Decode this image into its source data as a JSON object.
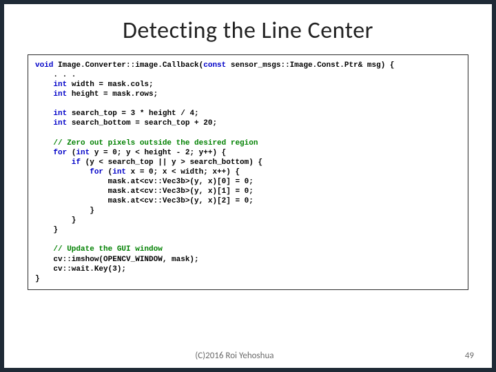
{
  "title": "Detecting the Line Center",
  "footer": {
    "copyright": "(C)2016 Roi Yehoshua",
    "page": "49"
  },
  "code": {
    "l1a": "void",
    "l1b": " Image.Converter::image.Callback(",
    "l1c": "const",
    "l1d": " sensor_msgs::Image.Const.Ptr& msg) {",
    "l2": "    . . .",
    "l3a": "    int",
    "l3b": " width = mask.cols;",
    "l4a": "    int",
    "l4b": " height = mask.rows;",
    "blank1": " ",
    "l5a": "    int",
    "l5b": " search_top = 3 * height / 4;",
    "l6a": "    int",
    "l6b": " search_bottom = search_top + 20;",
    "blank2": " ",
    "c1": "    // Zero out pixels outside the desired region",
    "l7a": "    for",
    "l7b": " (",
    "l7c": "int",
    "l7d": " y = 0; y < height - 2; y++) {",
    "l8a": "        if",
    "l8b": " (y < search_top || y > search_bottom) {",
    "l9a": "            for",
    "l9b": " (",
    "l9c": "int",
    "l9d": " x = 0; x < width; x++) {",
    "l10": "                mask.at<cv::Vec3b>(y, x)[0] = 0;",
    "l11": "                mask.at<cv::Vec3b>(y, x)[1] = 0;",
    "l12": "                mask.at<cv::Vec3b>(y, x)[2] = 0;",
    "l13": "            }",
    "l14": "        }",
    "l15": "    }",
    "blank3": " ",
    "c2": "    // Update the GUI window",
    "l16": "    cv::imshow(OPENCV_WINDOW, mask);",
    "l17": "    cv::wait.Key(3);",
    "l18": "}"
  }
}
